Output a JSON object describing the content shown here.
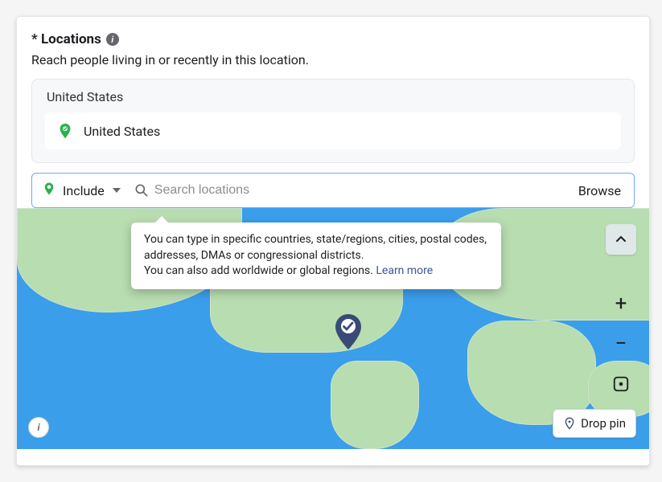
{
  "section": {
    "title": "* Locations",
    "subtitle": "Reach people living in or recently in this location."
  },
  "selected": {
    "groupHeader": "United States",
    "items": [
      {
        "label": "United States"
      }
    ]
  },
  "search": {
    "includeLabel": "Include",
    "placeholder": "Search locations",
    "browseLabel": "Browse"
  },
  "tooltip": {
    "line1": "You can type in specific countries, state/regions, cities, postal codes, addresses, DMAs or congressional districts.",
    "line2": "You can also add worldwide or global regions.",
    "learnMore": "Learn more"
  },
  "mapControls": {
    "collapse": "^",
    "zoomIn": "+",
    "zoomOut": "−",
    "dropPin": "Drop pin"
  },
  "colors": {
    "accentGreen": "#2bb24c",
    "pinNavy": "#3a4a77",
    "mapOcean": "#3b9eeb",
    "mapLand": "#b8ddb0"
  }
}
